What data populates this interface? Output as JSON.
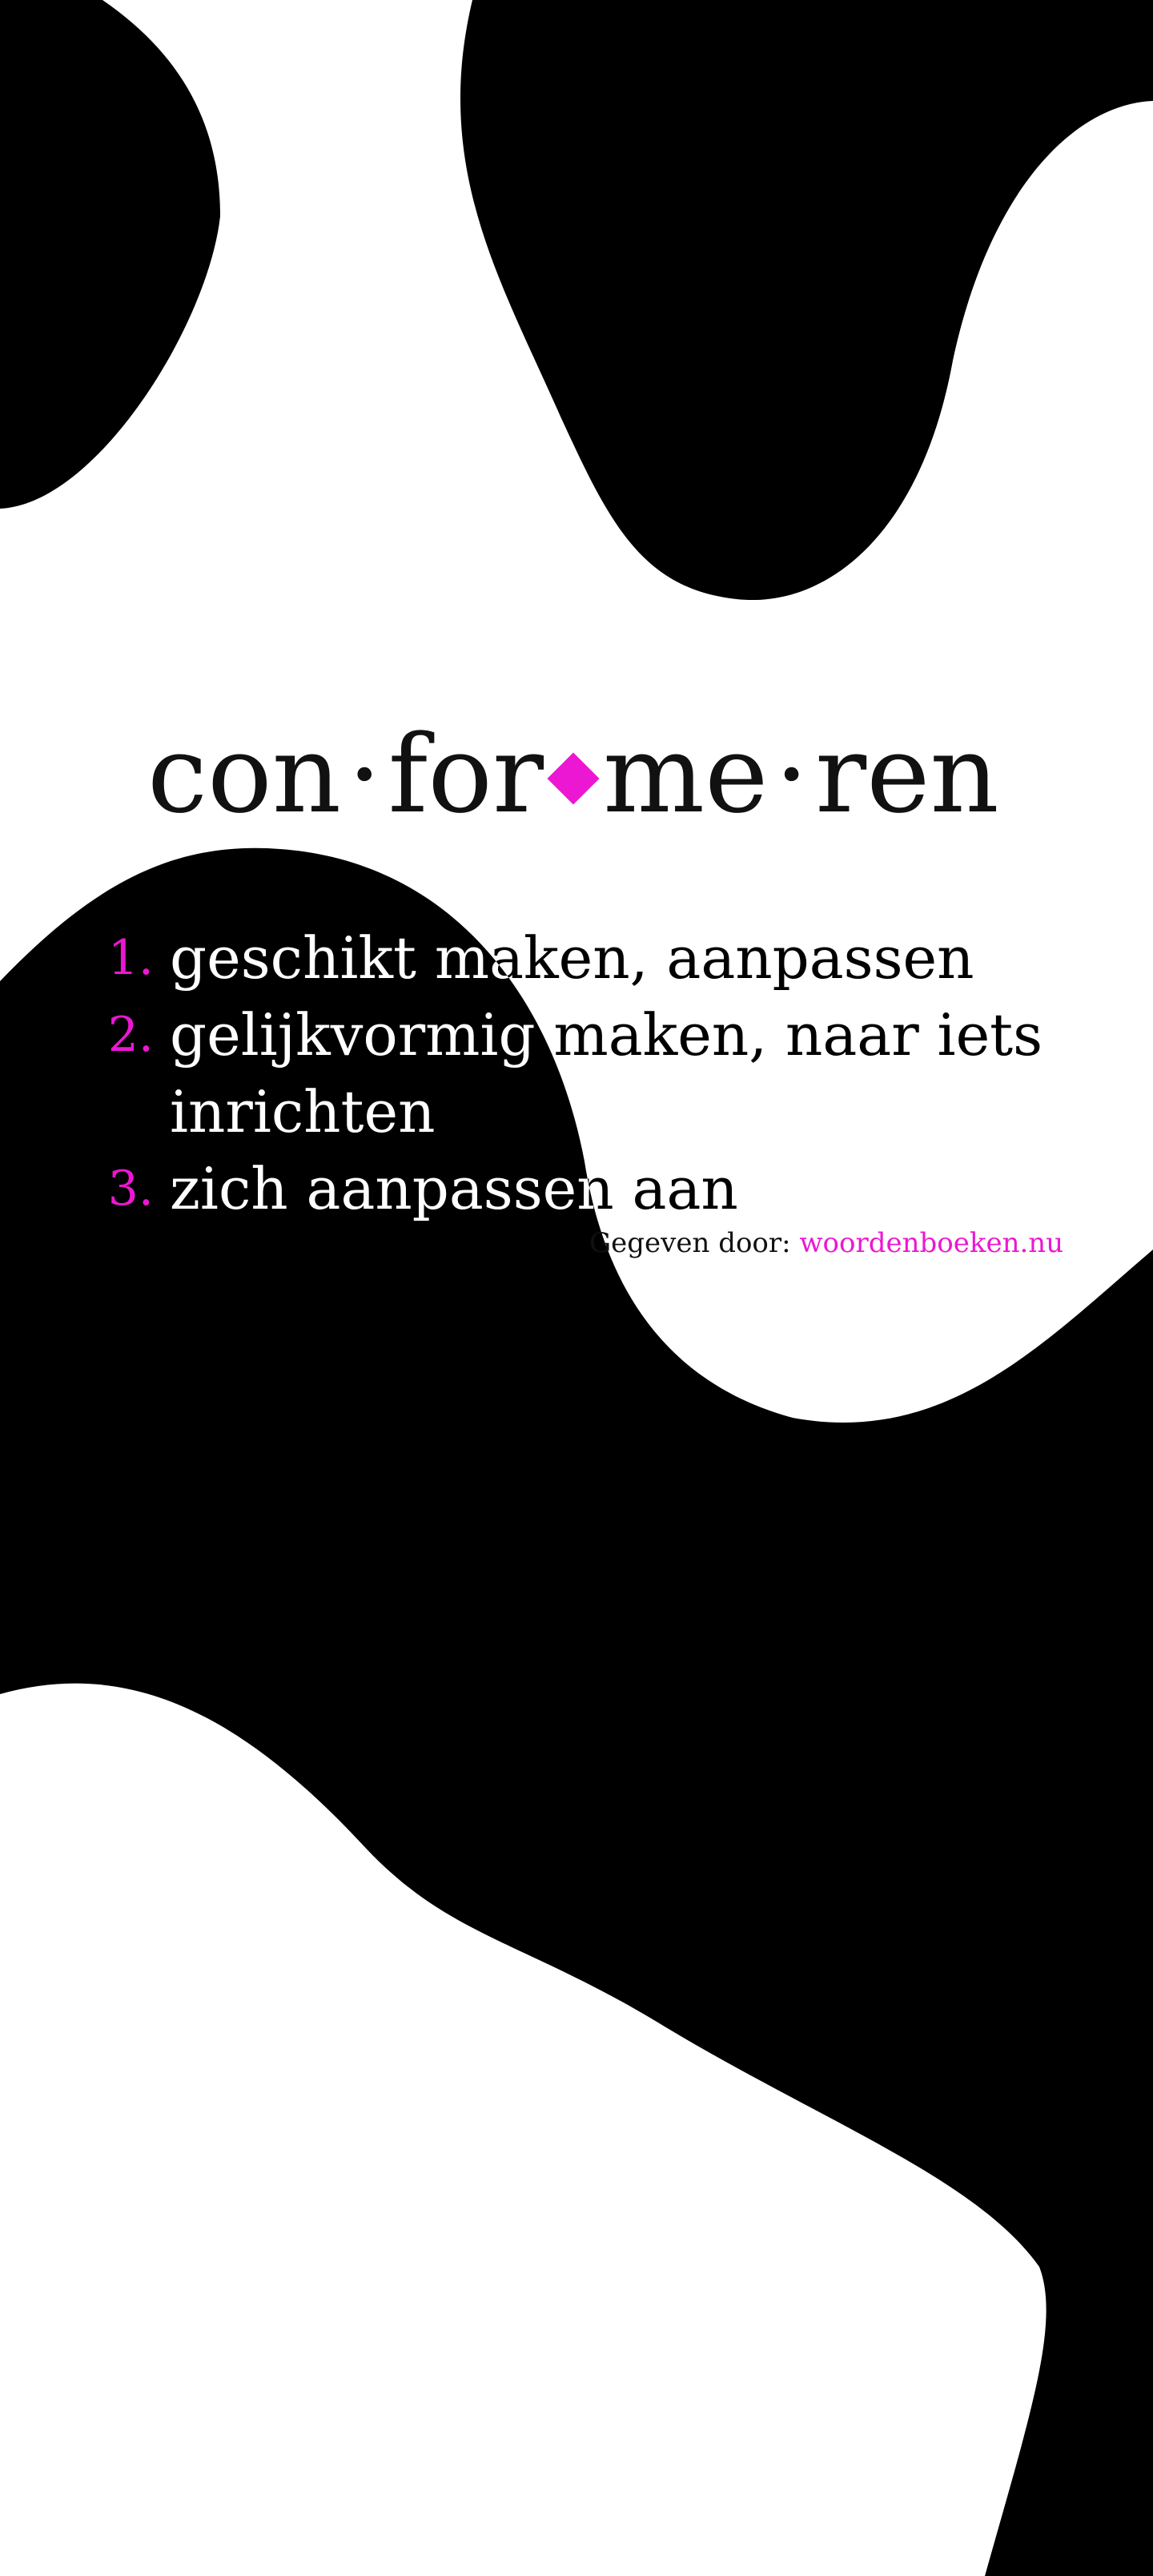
{
  "word": {
    "syllables": [
      "con",
      "for",
      "me",
      "ren"
    ],
    "separator_dot": "·"
  },
  "definitions": [
    {
      "number": "1.",
      "text": "geschikt maken, aanpassen"
    },
    {
      "number": "2.",
      "text": "gelijkvormig maken, naar iets inrichten"
    },
    {
      "number": "3.",
      "text": "zich aanpassen aan"
    }
  ],
  "credit": {
    "label": "Gegeven door:",
    "link_text": "woordenboeken.nu"
  },
  "colors": {
    "accent": "#ec17d2",
    "foreground": "#111111",
    "background": "#ffffff",
    "shape": "#000000"
  },
  "icons": {
    "stress_marker": "diamond-icon"
  }
}
